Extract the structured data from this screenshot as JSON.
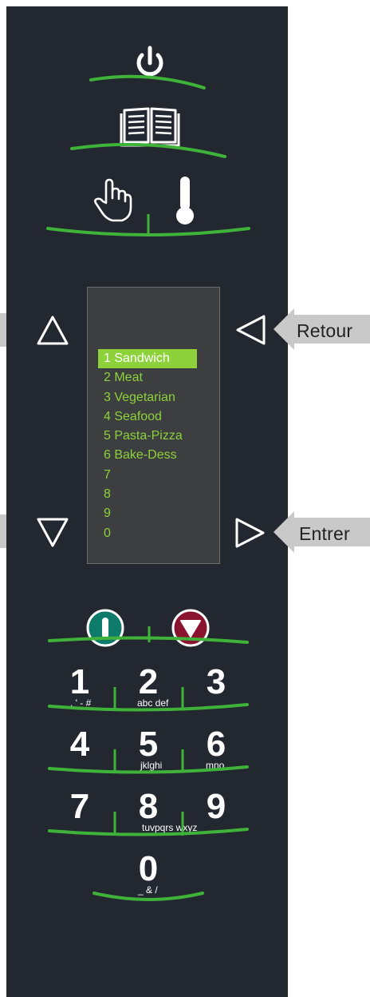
{
  "display": {
    "menu_items": [
      "1 Sandwich",
      "2 Meat",
      "3 Vegetarian",
      "4 Seafood",
      "5 Pasta-Pizza",
      "6 Bake-Dess",
      "7",
      "8",
      "9",
      "0"
    ],
    "selected_index": 0
  },
  "callouts": {
    "back_label": "Retour",
    "enter_label": "Entrer"
  },
  "keypad": {
    "keys": [
      {
        "digit": "1",
        "letters": ". ' - #"
      },
      {
        "digit": "2",
        "letters": "abc def"
      },
      {
        "digit": "3",
        "letters": ""
      },
      {
        "digit": "4",
        "letters": ""
      },
      {
        "digit": "5",
        "letters": "jklghi"
      },
      {
        "digit": "6",
        "letters": "mno"
      },
      {
        "digit": "7",
        "letters": ""
      },
      {
        "digit": "8",
        "letters": "tuvpqrs wxyz"
      },
      {
        "digit": "9",
        "letters": ""
      },
      {
        "digit": "0",
        "letters": "_ & /"
      }
    ]
  },
  "colors": {
    "panel": "#23272f",
    "accent_green": "#3fb23a",
    "display_text": "#8dd23a",
    "start_button": "#0e7a6a",
    "stop_button": "#8a1430"
  },
  "icons": [
    "power-icon",
    "recipe-book-icon",
    "manual-hand-icon",
    "thermometer-icon",
    "start-icon",
    "stop-icon",
    "up-arrow-icon",
    "down-arrow-icon",
    "back-arrow-icon",
    "enter-arrow-icon"
  ]
}
